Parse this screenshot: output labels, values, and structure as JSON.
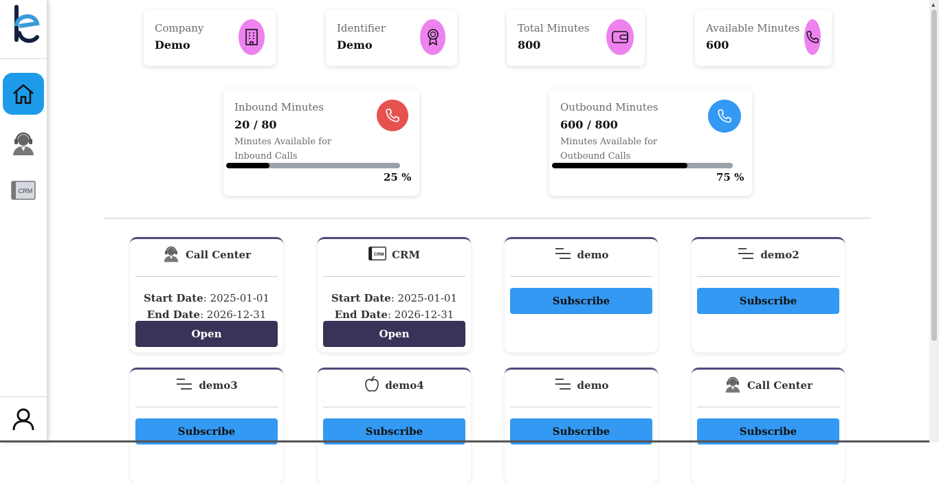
{
  "stats": [
    {
      "label": "Company",
      "value": "Demo",
      "icon": "building-icon"
    },
    {
      "label": "Identifier",
      "value": "Demo",
      "icon": "badge-icon"
    },
    {
      "label": "Total Minutes",
      "value": "800",
      "icon": "wallet-icon"
    },
    {
      "label": "Available Minutes",
      "value": "600",
      "icon": "phone-icon"
    }
  ],
  "minutes": [
    {
      "label": "Inbound Minutes",
      "value": "20 / 80",
      "desc": "Minutes Available for Inbound Calls",
      "percent_text": "25 %",
      "percent": 25,
      "icon_color": "#e5524f"
    },
    {
      "label": "Outbound Minutes",
      "value": "600 / 800",
      "desc": "Minutes Available for Outbound Calls",
      "percent_text": "75 %",
      "percent": 75,
      "icon_color": "#3399f3"
    }
  ],
  "services": [
    {
      "title": "Call Center",
      "icon": "agent-icon",
      "start_label": "Start Date",
      "start": ": 2025-01-01",
      "end_label": "End Date",
      "end": ": 2026-12-31",
      "button": "Open"
    },
    {
      "title": "CRM",
      "icon": "crm-icon",
      "start_label": "Start Date",
      "start": ": 2025-01-01",
      "end_label": "End Date",
      "end": ": 2026-12-31",
      "button": "Open"
    },
    {
      "title": "demo",
      "icon": "lines-icon",
      "button": "Subscribe"
    },
    {
      "title": "demo2",
      "icon": "lines-icon",
      "button": "Subscribe"
    },
    {
      "title": "demo3",
      "icon": "lines-icon",
      "button": "Subscribe"
    },
    {
      "title": "demo4",
      "icon": "apple-icon",
      "button": "Subscribe"
    },
    {
      "title": "demo",
      "icon": "lines-icon",
      "button": "Subscribe"
    },
    {
      "title": "Call Center",
      "icon": "agent-icon",
      "button": "Subscribe"
    }
  ],
  "sidebar": {
    "logo_letter": "e",
    "crm_label": "CRM",
    "items": [
      "home-icon",
      "call-center-icon",
      "crm-icon"
    ],
    "profile": "user-icon"
  },
  "colors": {
    "accent": "#1e9be8",
    "stat_icon": "#ee82ee",
    "open_button": "#3a3258",
    "subscribe_button": "#3399f3",
    "card_border": "#4e4a78"
  }
}
